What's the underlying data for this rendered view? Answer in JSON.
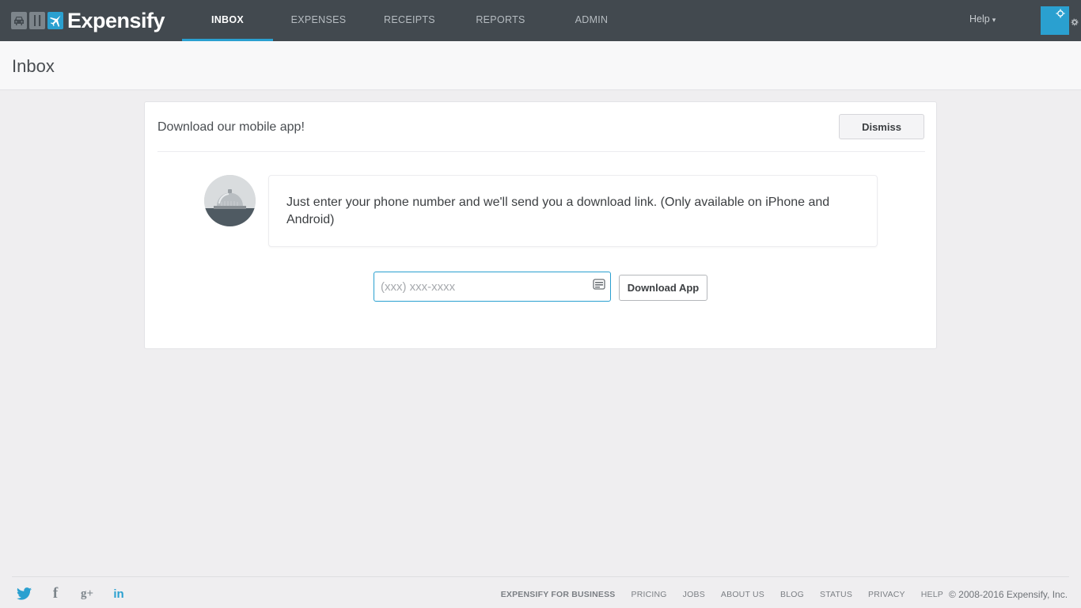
{
  "app": {
    "logo_text": "Expensify",
    "brand_color": "#2aa0d0",
    "topbar_color": "#42494f"
  },
  "nav": {
    "items": [
      {
        "label": "INBOX",
        "active": true
      },
      {
        "label": "EXPENSES",
        "active": false
      },
      {
        "label": "RECEIPTS",
        "active": false
      },
      {
        "label": "REPORTS",
        "active": false
      },
      {
        "label": "ADMIN",
        "active": false
      }
    ],
    "help_label": "Help",
    "help_caret": "▾"
  },
  "page": {
    "title": "Inbox"
  },
  "card": {
    "title": "Download our mobile app!",
    "dismiss_label": "Dismiss",
    "message": "Just enter your phone number and we'll send you a download link. (Only available on iPhone and Android)",
    "phone_placeholder": "(xxx) xxx-xxxx",
    "phone_value": "",
    "download_label": "Download App"
  },
  "footer": {
    "social": [
      {
        "name": "twitter-icon",
        "glyph": ""
      },
      {
        "name": "facebook-icon",
        "glyph": "f"
      },
      {
        "name": "google-plus-icon",
        "glyph": "g+"
      },
      {
        "name": "linkedin-icon",
        "glyph": "in"
      }
    ],
    "links": [
      "EXPENSIFY FOR BUSINESS",
      "PRICING",
      "JOBS",
      "ABOUT US",
      "BLOG",
      "STATUS",
      "PRIVACY",
      "HELP"
    ],
    "copyright": "© 2008-2016 Expensify, Inc."
  }
}
